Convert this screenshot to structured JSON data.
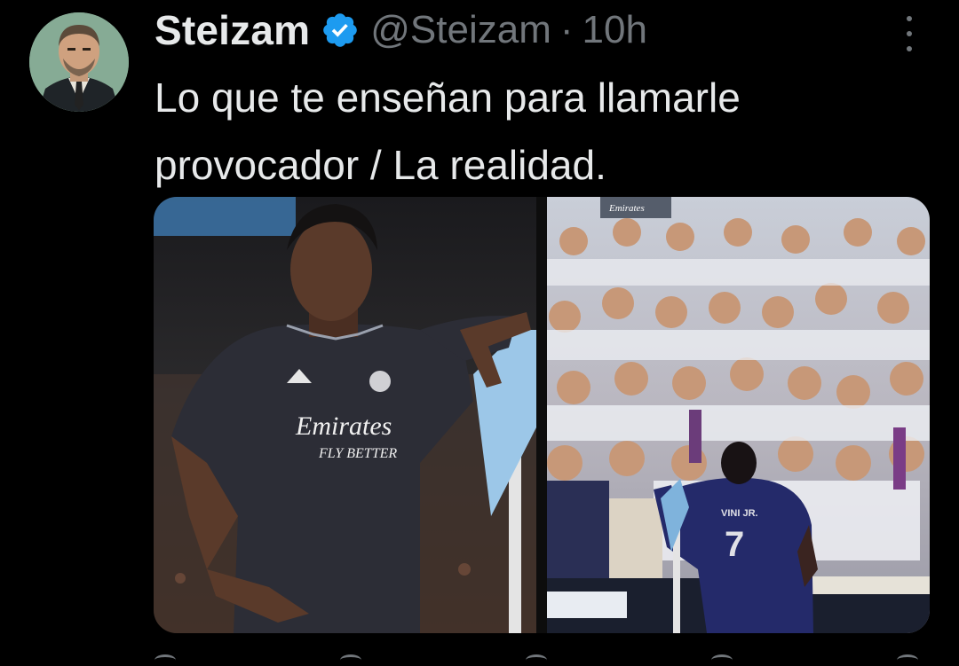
{
  "tweet": {
    "author_name": "Steizam",
    "handle": "@Steizam",
    "separator": "·",
    "timestamp": "10h",
    "text": "Lo que te enseñan para llamarle provocador / La realidad.",
    "jersey_text_left": "Emirates",
    "jersey_sub_left": "FLY BETTER",
    "banner_text_right": "Emirates",
    "shirt_name_right": "VINI JR.",
    "shirt_number_right": "7"
  },
  "icons": {
    "verified": "verified-badge-icon",
    "more": "more-options-icon"
  },
  "colors": {
    "background": "#000000",
    "primary_text": "#e7e9ea",
    "secondary_text": "#71767b",
    "verified_blue": "#1d9bf0"
  }
}
